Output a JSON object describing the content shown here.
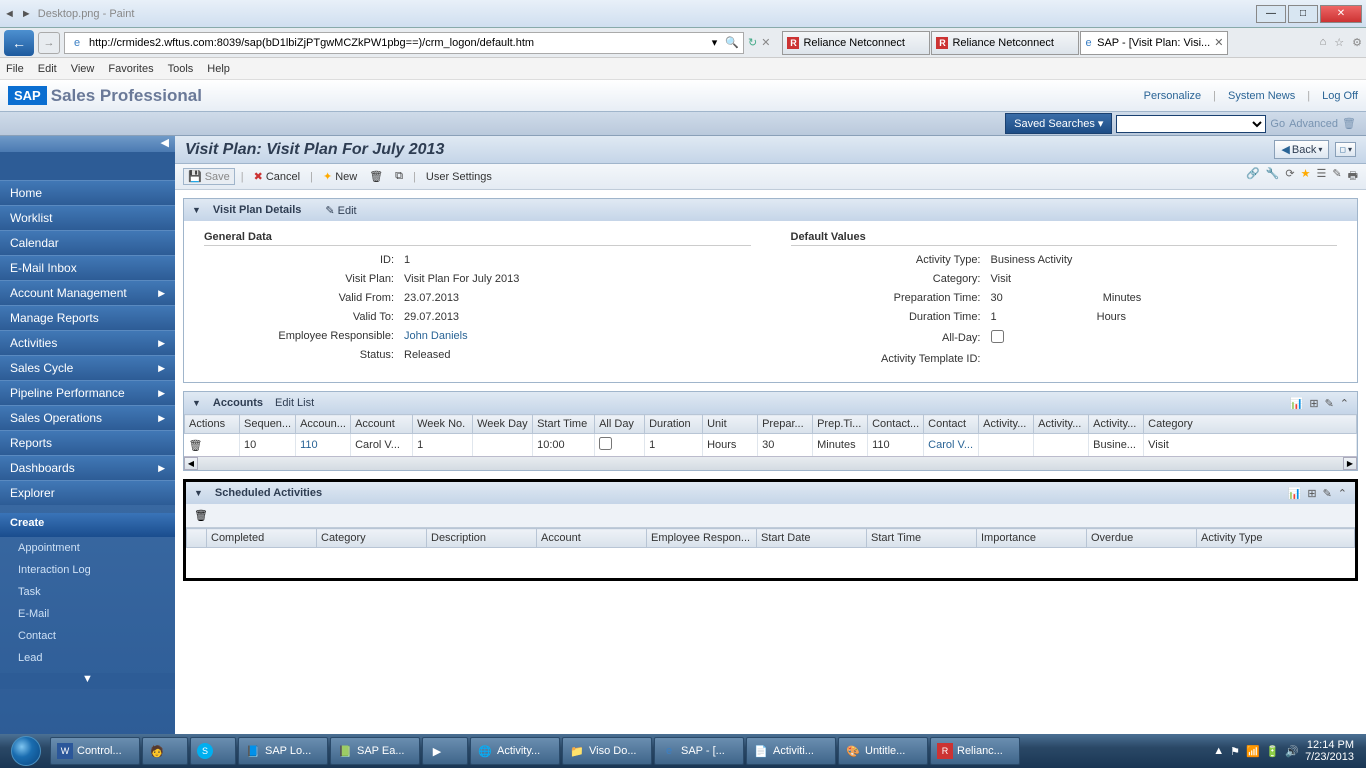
{
  "window": {
    "title": "Desktop.png - Paint"
  },
  "ie": {
    "url": "http://crmides2.wftus.com:8039/sap(bD1lbiZjPTgwMCZkPW1pbg==)/crm_logon/default.htm",
    "tabs": [
      {
        "label": "Reliance Netconnect"
      },
      {
        "label": "Reliance Netconnect"
      },
      {
        "label": "SAP - [Visit Plan: Visi..."
      }
    ]
  },
  "menubar": [
    "File",
    "Edit",
    "View",
    "Favorites",
    "Tools",
    "Help"
  ],
  "sap": {
    "brand": "SAP",
    "app": "Sales Professional",
    "links": {
      "personalize": "Personalize",
      "system_news": "System News",
      "logoff": "Log Off"
    },
    "saved_searches": "Saved Searches ▾",
    "go": "Go",
    "advanced": "Advanced"
  },
  "nav": {
    "items": [
      "Home",
      "Worklist",
      "Calendar",
      "E-Mail Inbox",
      "Account Management",
      "Manage Reports",
      "Activities",
      "Sales Cycle",
      "Pipeline Performance",
      "Sales Operations",
      "Reports",
      "Dashboards",
      "Explorer"
    ],
    "arrows": {
      "4": true,
      "6": true,
      "7": true,
      "8": true,
      "9": true,
      "11": true
    },
    "create_header": "Create",
    "create_items": [
      "Appointment",
      "Interaction Log",
      "Task",
      "E-Mail",
      "Contact",
      "Lead"
    ]
  },
  "page": {
    "title": "Visit Plan: Visit Plan For July 2013",
    "back": "Back",
    "toolbar": {
      "save": "Save",
      "cancel": "Cancel",
      "new": "New",
      "user_settings": "User Settings"
    }
  },
  "details": {
    "header": "Visit Plan Details",
    "edit": "Edit",
    "general_title": "General Data",
    "default_title": "Default Values",
    "fields": {
      "id_label": "ID:",
      "id": "1",
      "visit_plan_label": "Visit Plan:",
      "visit_plan": "Visit Plan For July 2013",
      "valid_from_label": "Valid From:",
      "valid_from": "23.07.2013",
      "valid_to_label": "Valid To:",
      "valid_to": "29.07.2013",
      "emp_label": "Employee Responsible:",
      "emp": "John Daniels",
      "status_label": "Status:",
      "status": "Released",
      "act_type_label": "Activity Type:",
      "act_type": "Business Activity",
      "category_label": "Category:",
      "category": "Visit",
      "prep_label": "Preparation Time:",
      "prep": "30",
      "prep_unit": "Minutes",
      "dur_label": "Duration Time:",
      "dur": "1",
      "dur_unit": "Hours",
      "allday_label": "All-Day:",
      "tmpl_label": "Activity Template ID:"
    }
  },
  "accounts": {
    "header": "Accounts",
    "edit_list": "Edit List",
    "cols": [
      "Actions",
      "Sequen...",
      "Accoun...",
      "Account",
      "Week No.",
      "Week Day",
      "Start Time",
      "All Day",
      "Duration",
      "Unit",
      "Prepar...",
      "Prep.Ti...",
      "Contact...",
      "Contact",
      "Activity...",
      "Activity...",
      "Activity...",
      "Category"
    ],
    "row": {
      "seq": "10",
      "acc_id": "110",
      "account": "Carol V...",
      "week_no": "1",
      "start": "10:00",
      "dur": "1",
      "unit": "Hours",
      "prep": "30",
      "prep_unit": "Minutes",
      "contact_id": "110",
      "contact": "Carol V...",
      "act3": "Busine...",
      "cat": "Visit"
    }
  },
  "scheduled": {
    "header": "Scheduled Activities",
    "cols": [
      "",
      "Completed",
      "Category",
      "Description",
      "Account",
      "Employee Respon...",
      "Start Date",
      "Start Time",
      "Importance",
      "Overdue",
      "Activity Type"
    ]
  },
  "taskbar": {
    "items": [
      "Control...",
      "",
      "",
      "SAP Lo...",
      "SAP Ea...",
      "",
      "Activity...",
      "Viso Do...",
      "SAP - [...",
      "Activiti...",
      "Untitle...",
      "Relianc..."
    ],
    "time": "12:14 PM",
    "date": "7/23/2013"
  }
}
